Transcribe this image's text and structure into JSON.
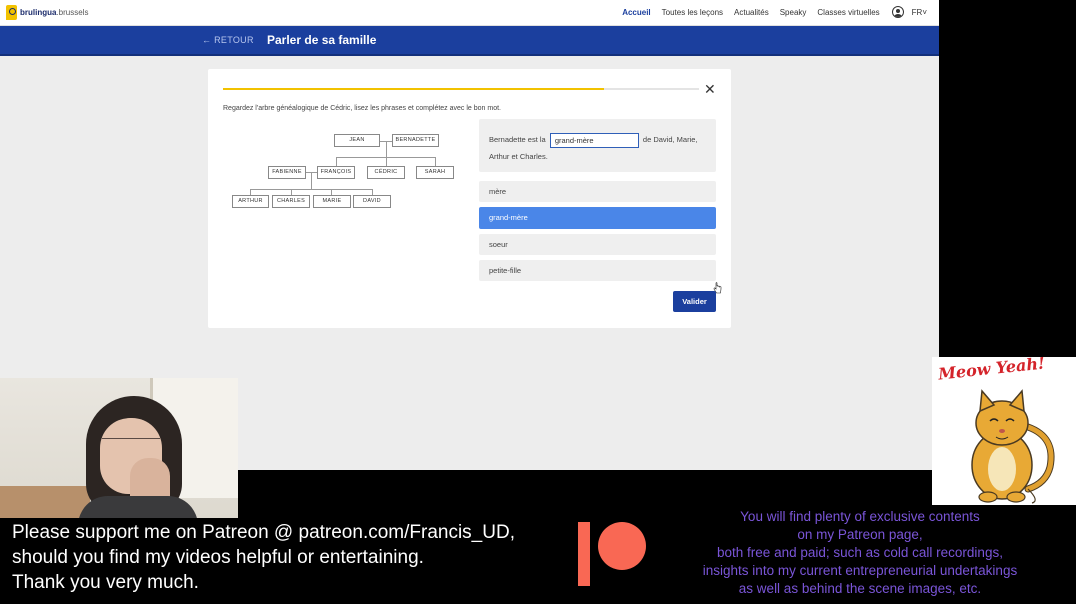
{
  "site": {
    "logo_brand": "brulingua",
    "logo_domain": ".brussels"
  },
  "nav": {
    "items": [
      {
        "label": "Accueil",
        "active": true
      },
      {
        "label": "Toutes les leçons",
        "active": false
      },
      {
        "label": "Actualités",
        "active": false
      },
      {
        "label": "Speaky",
        "active": false
      },
      {
        "label": "Classes virtuelles",
        "active": false
      }
    ],
    "language": "FR˅"
  },
  "lesson": {
    "back_label": "← RETOUR",
    "title": "Parler de sa famille"
  },
  "exercise": {
    "progress": 0.8,
    "close_icon": "✕",
    "instruction": "Regardez l'arbre généalogique de Cédric, lisez les phrases et complétez avec le bon mot.",
    "tree": {
      "grandparents": [
        "JEAN",
        "BERNADETTE"
      ],
      "parents": [
        "FABIENNE",
        "FRANÇOIS",
        "CÉDRIC",
        "SARAH"
      ],
      "children": [
        "ARTHUR",
        "CHARLES",
        "MARIE",
        "DAVID"
      ]
    },
    "sentence_before": "Bernadette est la",
    "answer_value": "grand-mère",
    "sentence_after": "de David, Marie, Arthur et Charles.",
    "options": [
      {
        "label": "mère",
        "selected": false
      },
      {
        "label": "grand-mère",
        "selected": true
      },
      {
        "label": "soeur",
        "selected": false
      },
      {
        "label": "petite-fille",
        "selected": false
      }
    ],
    "validate_label": "Valider"
  },
  "sticker": {
    "caption": "Meow Yeah!"
  },
  "overlay": {
    "support_lines": [
      "Please support me on Patreon @ patreon.com/Francis_UD,",
      "should you find my videos helpful or entertaining.",
      "Thank you very much."
    ],
    "promo_lines": [
      "You will find plenty of exclusive contents",
      "on my Patreon page,",
      "both free and paid; such as cold call recordings,",
      "insights into my current entrepreneurial undertakings",
      "as well as behind the scene images, etc."
    ]
  },
  "colors": {
    "brand_blue": "#1b3f9e",
    "selected_blue": "#4a86e8",
    "progress_yellow": "#f2c200",
    "patreon_red": "#f96854",
    "promo_purple": "#7a55d8"
  }
}
